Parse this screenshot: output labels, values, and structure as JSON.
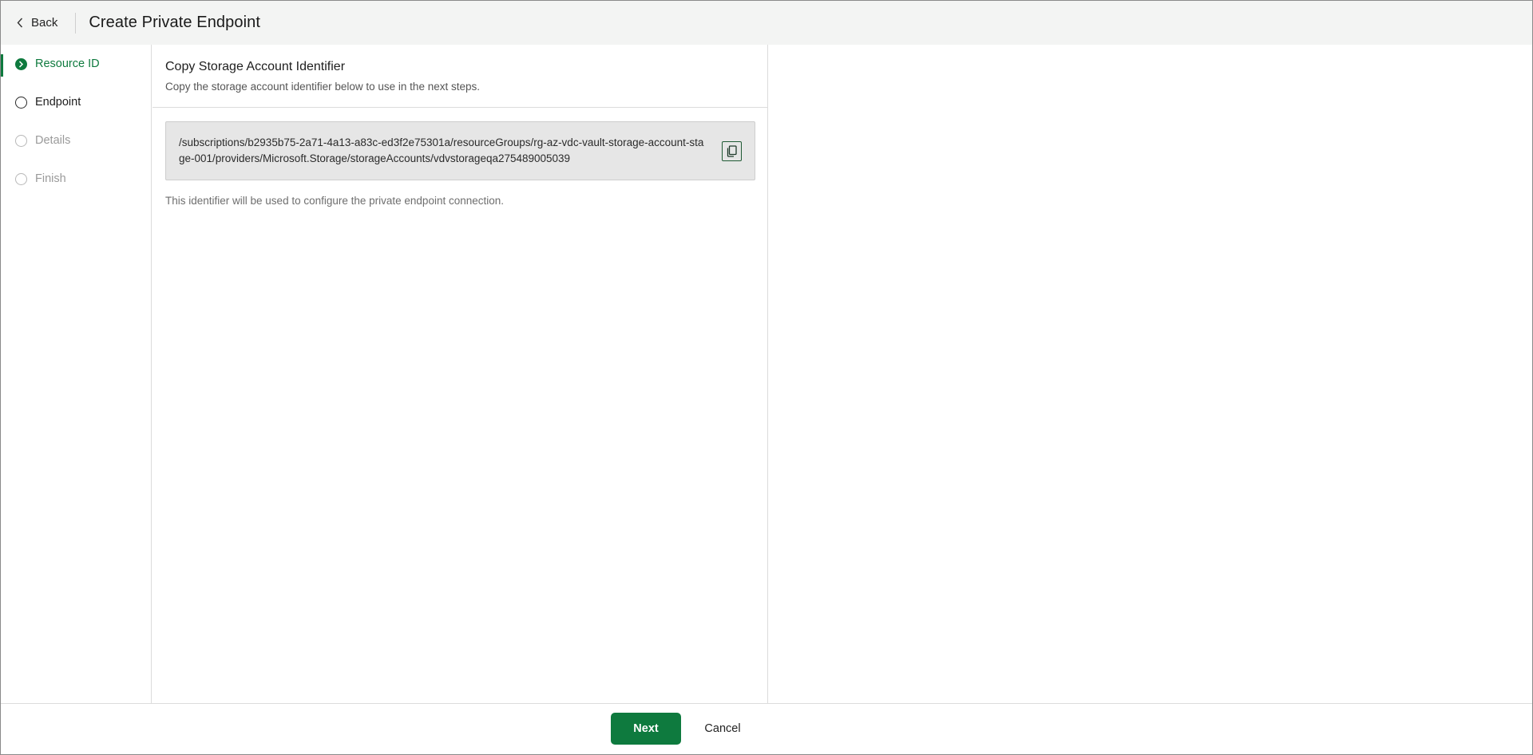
{
  "header": {
    "back_label": "Back",
    "title": "Create Private Endpoint"
  },
  "steps": [
    {
      "label": "Resource ID",
      "state": "active"
    },
    {
      "label": "Endpoint",
      "state": "current"
    },
    {
      "label": "Details",
      "state": "disabled"
    },
    {
      "label": "Finish",
      "state": "disabled"
    }
  ],
  "main": {
    "section_title": "Copy Storage Account Identifier",
    "section_desc": "Copy the storage account identifier below to use in the next steps.",
    "identifier": "/subscriptions/b2935b75-2a71-4a13-a83c-ed3f2e75301a/resourceGroups/rg-az-vdc-vault-storage-account-stage-001/providers/Microsoft.Storage/storageAccounts/vdvstorageqa275489005039",
    "hint": "This identifier will be used to configure the private endpoint connection."
  },
  "footer": {
    "next_label": "Next",
    "cancel_label": "Cancel"
  },
  "colors": {
    "accent": "#0e7a3e",
    "header_bg": "#f3f4f3",
    "id_box_bg": "#e6e6e6"
  },
  "icons": {
    "back": "chevron-left-icon",
    "step_active": "chevron-right-circle-icon",
    "step_pending": "empty-circle-icon",
    "copy": "copy-icon"
  }
}
